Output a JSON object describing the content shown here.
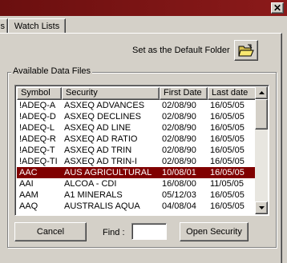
{
  "window": {
    "close_glyph": "✕"
  },
  "tabs": [
    {
      "label": "s"
    },
    {
      "label": "Watch Lists"
    }
  ],
  "default_folder": {
    "label": "Set as the Default Folder",
    "icon": "open-folder-icon"
  },
  "data_files": {
    "group_label": "Available Data Files",
    "columns": [
      "Symbol",
      "Security",
      "First  Date",
      "Last date"
    ],
    "rows": [
      {
        "symbol": "!ADEQ-A",
        "security": "ASXEQ ADVANCES",
        "first_date": "02/08/90",
        "last_date": "16/05/05"
      },
      {
        "symbol": "!ADEQ-D",
        "security": "ASXEQ DECLINES",
        "first_date": "02/08/90",
        "last_date": "16/05/05"
      },
      {
        "symbol": "!ADEQ-L",
        "security": "ASXEQ AD LINE",
        "first_date": "02/08/90",
        "last_date": "16/05/05"
      },
      {
        "symbol": "!ADEQ-R",
        "security": "ASXEQ AD RATIO",
        "first_date": "02/08/90",
        "last_date": "16/05/05"
      },
      {
        "symbol": "!ADEQ-T",
        "security": "ASXEQ AD TRIN",
        "first_date": "02/08/90",
        "last_date": "16/05/05"
      },
      {
        "symbol": "!ADEQ-TI",
        "security": "ASXEQ AD TRIN-I",
        "first_date": "02/08/90",
        "last_date": "16/05/05"
      },
      {
        "symbol": "AAC",
        "security": "AUS AGRICULTURAL",
        "first_date": "10/08/01",
        "last_date": "16/05/05",
        "selected": true
      },
      {
        "symbol": "AAI",
        "security": "ALCOA - CDI",
        "first_date": "16/08/00",
        "last_date": "11/05/05"
      },
      {
        "symbol": "AAM",
        "security": "A1 MINERALS",
        "first_date": "05/12/03",
        "last_date": "16/05/05"
      },
      {
        "symbol": "AAQ",
        "security": "AUSTRALIS AQUA",
        "first_date": "04/08/04",
        "last_date": "16/05/05"
      }
    ]
  },
  "footer": {
    "cancel_label": "Cancel",
    "find_label": "Find :",
    "find_value": "",
    "open_label": "Open Security"
  },
  "colors": {
    "title_bar": "#6b0f0f",
    "selection": "#800000",
    "face": "#d4d0c8"
  }
}
